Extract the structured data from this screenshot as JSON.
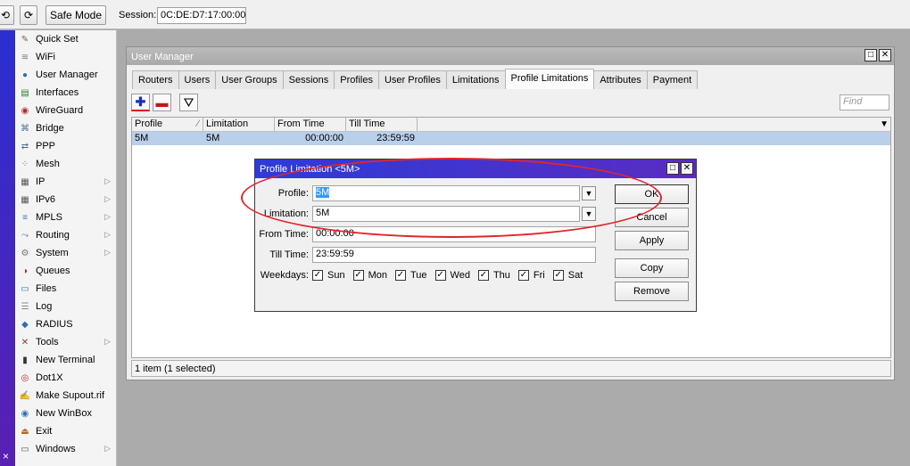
{
  "toolbar": {
    "undo_icon": "undo-icon",
    "redo_icon": "redo-icon",
    "safe_mode": "Safe Mode",
    "session_label": "Session:",
    "session_value": "0C:DE:D7:17:00:00"
  },
  "strip": {
    "close": "×"
  },
  "sidebar": {
    "items": [
      {
        "label": "Quick Set",
        "icon": "wand-icon",
        "color": "#7b6a3c",
        "submenu": false
      },
      {
        "label": "WiFi",
        "icon": "wifi-icon",
        "color": "#7a7a7a",
        "submenu": false
      },
      {
        "label": "User Manager",
        "icon": "users-icon",
        "color": "#2d6fb3",
        "submenu": false
      },
      {
        "label": "Interfaces",
        "icon": "interfaces-icon",
        "color": "#2b7b2b",
        "submenu": false
      },
      {
        "label": "WireGuard",
        "icon": "wireguard-icon",
        "color": "#b02a2a",
        "submenu": false
      },
      {
        "label": "Bridge",
        "icon": "bridge-icon",
        "color": "#4a6aa0",
        "submenu": false
      },
      {
        "label": "PPP",
        "icon": "ppp-icon",
        "color": "#4a6aa0",
        "submenu": false
      },
      {
        "label": "Mesh",
        "icon": "mesh-icon",
        "color": "#4a6aa0",
        "submenu": false
      },
      {
        "label": "IP",
        "icon": "ip-icon",
        "color": "#555555",
        "submenu": true
      },
      {
        "label": "IPv6",
        "icon": "ipv6-icon",
        "color": "#555555",
        "submenu": true
      },
      {
        "label": "MPLS",
        "icon": "mpls-icon",
        "color": "#3c6fc4",
        "submenu": true
      },
      {
        "label": "Routing",
        "icon": "routing-icon",
        "color": "#3c6fc4",
        "submenu": true
      },
      {
        "label": "System",
        "icon": "system-icon",
        "color": "#777777",
        "submenu": true
      },
      {
        "label": "Queues",
        "icon": "queues-icon",
        "color": "#b32a2a",
        "submenu": false
      },
      {
        "label": "Files",
        "icon": "files-icon",
        "color": "#2d6fb3",
        "submenu": false
      },
      {
        "label": "Log",
        "icon": "log-icon",
        "color": "#888888",
        "submenu": false
      },
      {
        "label": "RADIUS",
        "icon": "radius-icon",
        "color": "#2d6fb3",
        "submenu": false
      },
      {
        "label": "Tools",
        "icon": "tools-icon",
        "color": "#8a3a3a",
        "submenu": true
      },
      {
        "label": "New Terminal",
        "icon": "terminal-icon",
        "color": "#333333",
        "submenu": false
      },
      {
        "label": "Dot1X",
        "icon": "dot1x-icon",
        "color": "#b02a2a",
        "submenu": false
      },
      {
        "label": "Make Supout.rif",
        "icon": "supout-icon",
        "color": "#444444",
        "submenu": false
      },
      {
        "label": "New WinBox",
        "icon": "winbox-icon",
        "color": "#2d6fb3",
        "submenu": false
      },
      {
        "label": "Exit",
        "icon": "exit-icon",
        "color": "#b8641e",
        "submenu": false
      },
      {
        "label": "Windows",
        "icon": "windows-icon",
        "color": "#555555",
        "submenu": true
      }
    ]
  },
  "um": {
    "title": "User Manager",
    "tabs": [
      "Routers",
      "Users",
      "User Groups",
      "Sessions",
      "Profiles",
      "User Profiles",
      "Limitations",
      "Profile Limitations",
      "Attributes",
      "Payment"
    ],
    "active_tab": 7,
    "find_placeholder": "Find",
    "columns": [
      "Profile",
      "Limitation",
      "From Time",
      "Till Time"
    ],
    "rows": [
      {
        "profile": "5M",
        "limitation": "5M",
        "from": "00:00:00",
        "till": "23:59:59"
      }
    ],
    "status": "1 item (1 selected)"
  },
  "dialog": {
    "title": "Profile Limitation <5M>",
    "profile_label": "Profile:",
    "profile_value": "5M",
    "limitation_label": "Limitation:",
    "limitation_value": "5M",
    "from_label": "From Time:",
    "from_value": "00:00:00",
    "till_label": "Till Time:",
    "till_value": "23:59:59",
    "weekdays_label": "Weekdays:",
    "days": [
      "Sun",
      "Mon",
      "Tue",
      "Wed",
      "Thu",
      "Fri",
      "Sat"
    ],
    "buttons": {
      "ok": "OK",
      "cancel": "Cancel",
      "apply": "Apply",
      "copy": "Copy",
      "remove": "Remove"
    }
  },
  "colors": {
    "annotation": "#e0262b",
    "dialog_title": "#2d3bd8",
    "selection": "#b9cfea"
  }
}
